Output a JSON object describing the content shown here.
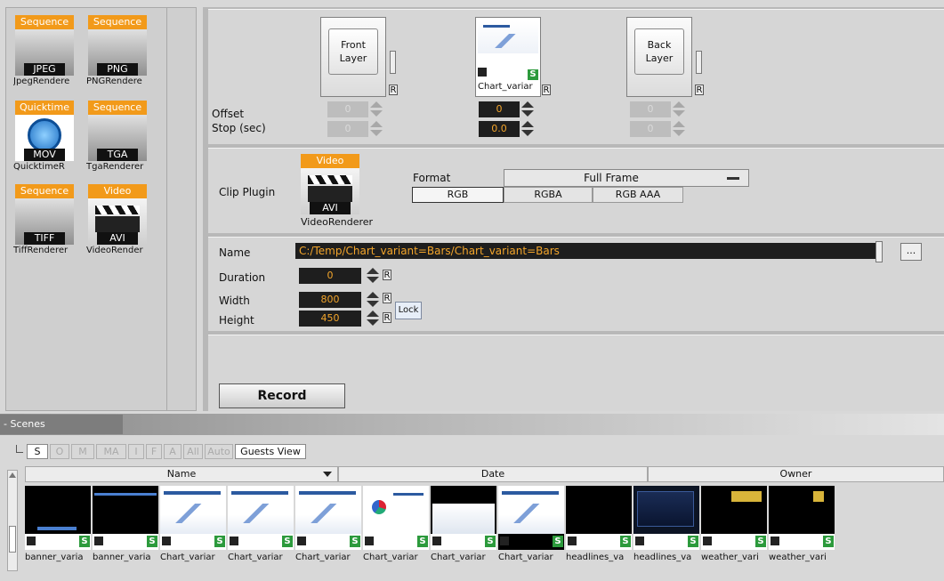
{
  "renderers": [
    {
      "tag": "Sequence",
      "format": "JPEG",
      "name": "JpegRendere"
    },
    {
      "tag": "Sequence",
      "format": "PNG",
      "name": "PNGRendere"
    },
    {
      "tag": "Quicktime",
      "format": "MOV",
      "name": "QuicktimeR"
    },
    {
      "tag": "Sequence",
      "format": "TGA",
      "name": "TgaRenderer"
    },
    {
      "tag": "Sequence",
      "format": "TIFF",
      "name": "TiffRenderer"
    },
    {
      "tag": "Video",
      "format": "AVI",
      "name": "VideoRender"
    }
  ],
  "layers": {
    "front": {
      "label": "Front Layer",
      "r": "R",
      "offset": "0",
      "stop": "0"
    },
    "main": {
      "name": "Chart_variar",
      "r": "R",
      "badge": "S",
      "offset": "0",
      "stop": "0.0"
    },
    "back": {
      "label": "Back Layer",
      "r": "R",
      "offset": "0",
      "stop": "0"
    },
    "offset_label": "Offset",
    "stop_label": "Stop (sec)"
  },
  "clip": {
    "label": "Clip Plugin",
    "plugin_tag": "Video",
    "plugin_format": "AVI",
    "plugin_name": "VideoRenderer",
    "format_label": "Format",
    "format_value": "Full Frame",
    "buttons": [
      "RGB",
      "RGBA",
      "RGB AAA"
    ]
  },
  "output": {
    "name_label": "Name",
    "name_value": "C:/Temp/Chart_variant=Bars/Chart_variant=Bars",
    "browse": "...",
    "duration_label": "Duration",
    "duration_value": "0",
    "width_label": "Width",
    "width_value": "800",
    "height_label": "Height",
    "height_value": "450",
    "lock": "Lock",
    "r": "R"
  },
  "record_label": "Record",
  "scenes": {
    "title": "- Scenes",
    "tabs": [
      "S",
      "O",
      "M",
      "MA",
      "I",
      "F",
      "A",
      "All",
      "Auto",
      "Guests View"
    ],
    "columns": [
      "Name",
      "Date",
      "Owner"
    ],
    "badge": "S",
    "items": [
      {
        "name": "banner_varia",
        "kind": "black"
      },
      {
        "name": "banner_varia",
        "kind": "black"
      },
      {
        "name": "Chart_variar",
        "kind": "chart"
      },
      {
        "name": "Chart_variar",
        "kind": "chart"
      },
      {
        "name": "Chart_variar",
        "kind": "chart"
      },
      {
        "name": "Chart_variar",
        "kind": "chart"
      },
      {
        "name": "Chart_variar",
        "kind": "chart"
      },
      {
        "name": "Chart_variar",
        "kind": "chart"
      },
      {
        "name": "headlines_va",
        "kind": "black"
      },
      {
        "name": "headlines_va",
        "kind": "black"
      },
      {
        "name": "weather_vari",
        "kind": "weather"
      },
      {
        "name": "weather_vari",
        "kind": "weather"
      }
    ]
  }
}
